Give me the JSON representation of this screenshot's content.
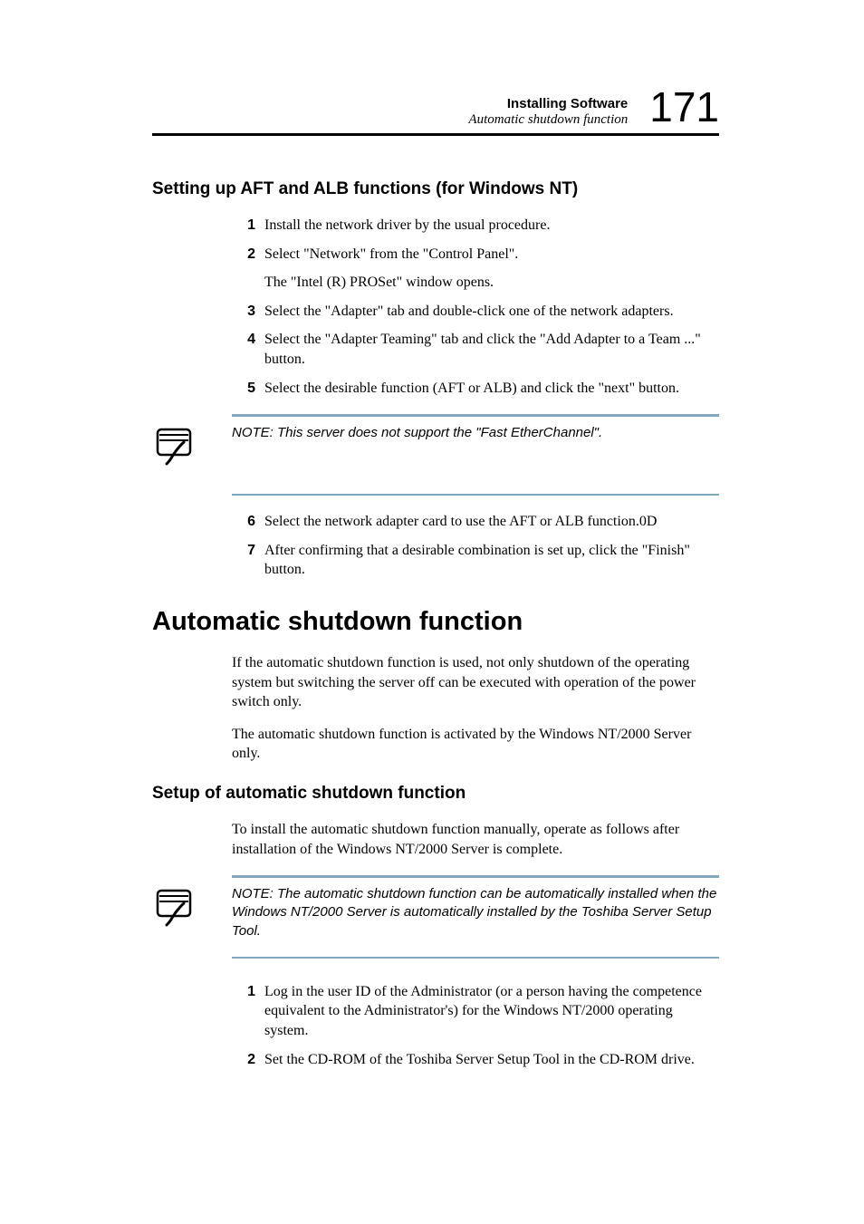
{
  "header": {
    "title": "Installing Software",
    "subtitle": "Automatic shutdown function",
    "page_number": "171"
  },
  "section1": {
    "heading": "Setting up AFT and ALB functions (for Windows NT)",
    "items": {
      "i1": {
        "num": "1",
        "text": "Install the network driver by the usual procedure."
      },
      "i2": {
        "num": "2",
        "text": "Select \"Network\" from the \"Control Panel\"."
      },
      "i2sub": "The \"Intel (R) PROSet\" window opens.",
      "i3": {
        "num": "3",
        "text": "Select the \"Adapter\" tab and double-click one of the network adapters."
      },
      "i4": {
        "num": "4",
        "text": "Select the \"Adapter Teaming\" tab and click the \"Add Adapter to a Team ...\" button."
      },
      "i5": {
        "num": "5",
        "text": "Select the desirable function (AFT or ALB) and click the \"next\" button."
      }
    },
    "note": "NOTE: This server does not support the \"Fast EtherChannel\".",
    "items2": {
      "i6": {
        "num": "6",
        "text": "Select the network adapter card to use the AFT or ALB function.0D"
      },
      "i7": {
        "num": "7",
        "text": "After confirming that a desirable combination is set up, click the \"Finish\" button."
      }
    }
  },
  "section2": {
    "heading": "Automatic shutdown function",
    "para1": "If the automatic shutdown function is used, not only shutdown of the operating system but switching the server off can be executed with operation of the power switch only.",
    "para2": "The automatic shutdown function is activated by the Windows NT/2000 Server only."
  },
  "section3": {
    "heading": "Setup of automatic shutdown function",
    "para1": "To install the automatic shutdown function manually, operate as follows after installation of the Windows NT/2000 Server is complete.",
    "note": "NOTE: The automatic shutdown function can be automatically installed when the Windows NT/2000 Server is automatically installed by the Toshiba Server Setup Tool.",
    "items": {
      "i1": {
        "num": "1",
        "text": "Log in the user ID of the Administrator (or a person having the competence equivalent to the Administrator's) for the Windows NT/2000 operating system."
      },
      "i2": {
        "num": "2",
        "text": "Set the CD-ROM of the Toshiba Server Setup Tool in the CD-ROM drive."
      }
    }
  }
}
